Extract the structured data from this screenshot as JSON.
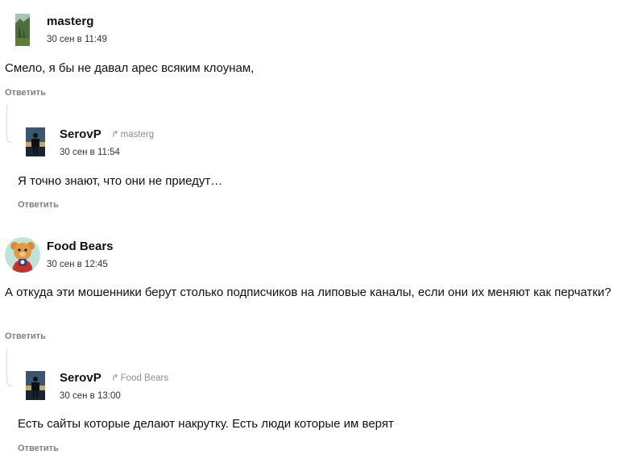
{
  "comments": [
    {
      "author": "masterg",
      "avatar": "avatar-landscape",
      "time": "30 сен в 11:49",
      "text": "Смело, я бы не давал арес всяким клоунам,",
      "reply_label": "Ответить",
      "replies": [
        {
          "author": "SerovP",
          "avatar": "avatar-silhouette",
          "reply_to": "masterg",
          "time": "30 сен в 11:54",
          "text": "Я точно знают, что они не приедут…",
          "reply_label": "Ответить"
        }
      ]
    },
    {
      "author": "Food Bears",
      "avatar": "avatar-bear",
      "time": "30 сен в 12:45",
      "text": "А откуда эти мошенники берут столько подписчиков на липовые каналы, если они их меняют как перчатки?",
      "reply_label": "Ответить",
      "replies": [
        {
          "author": "SerovP",
          "avatar": "avatar-silhouette",
          "reply_to": "Food Bears",
          "time": "30 сен в 13:00",
          "text": "Есть сайты которые делают накрутку. Есть люди которые им верят",
          "reply_label": "Ответить"
        }
      ]
    }
  ],
  "colors": {
    "text": "#111111",
    "muted": "#7b8088",
    "thread_line": "#d7d9dd"
  }
}
